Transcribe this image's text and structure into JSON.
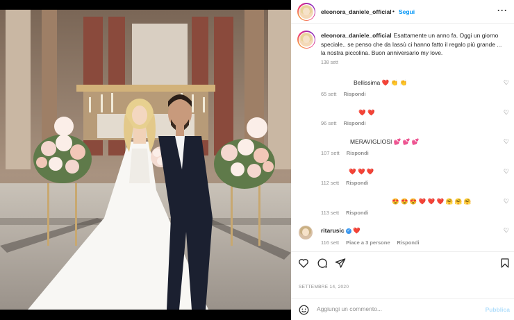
{
  "post": {
    "username": "eleonora_daniele_official",
    "separator": "•",
    "follow_label": "Segui",
    "more_label": "···",
    "caption": "Esattamente un anno fa. Oggi un giorno speciale.. se penso che da lassù ci hanno fatto il regalo più grande ... la nostra piccolina. Buon anniversario my love.",
    "caption_time": "138 sett"
  },
  "comments": [
    {
      "text": "Bellissima ❤️ 👏 👏",
      "time": "65 sett",
      "reply": "Rispondi"
    },
    {
      "text": "❤️ ❤️",
      "time": "96 sett",
      "reply": "Rispondi"
    },
    {
      "text": "MERAVIGLIOSI 💕 💕 💕",
      "time": "107 sett",
      "reply": "Rispondi"
    },
    {
      "text": "❤️ ❤️ ❤️",
      "time": "112 sett",
      "reply": "Rispondi"
    },
    {
      "text": "😍 😍 😍 ❤️ ❤️ ❤️ 🤗 🤗 🤗",
      "time": "113 sett",
      "reply": "Rispondi"
    },
    {
      "username": "ritarusic",
      "text": "❤️",
      "time": "116 sett",
      "likes": "Piace a 3 persone",
      "reply": "Rispondi"
    }
  ],
  "date": "SETTEMBRE 14, 2020",
  "add_comment": {
    "placeholder": "Aggiungi un commento...",
    "publish_label": "Pubblica"
  },
  "colors": {
    "accent": "#0095f6",
    "heart": "#ed1c45",
    "muted": "#8e8e8e"
  },
  "icons": [
    "heart-icon",
    "comment-icon",
    "share-icon",
    "bookmark-icon",
    "emoji-icon",
    "verified-icon",
    "more-icon"
  ]
}
